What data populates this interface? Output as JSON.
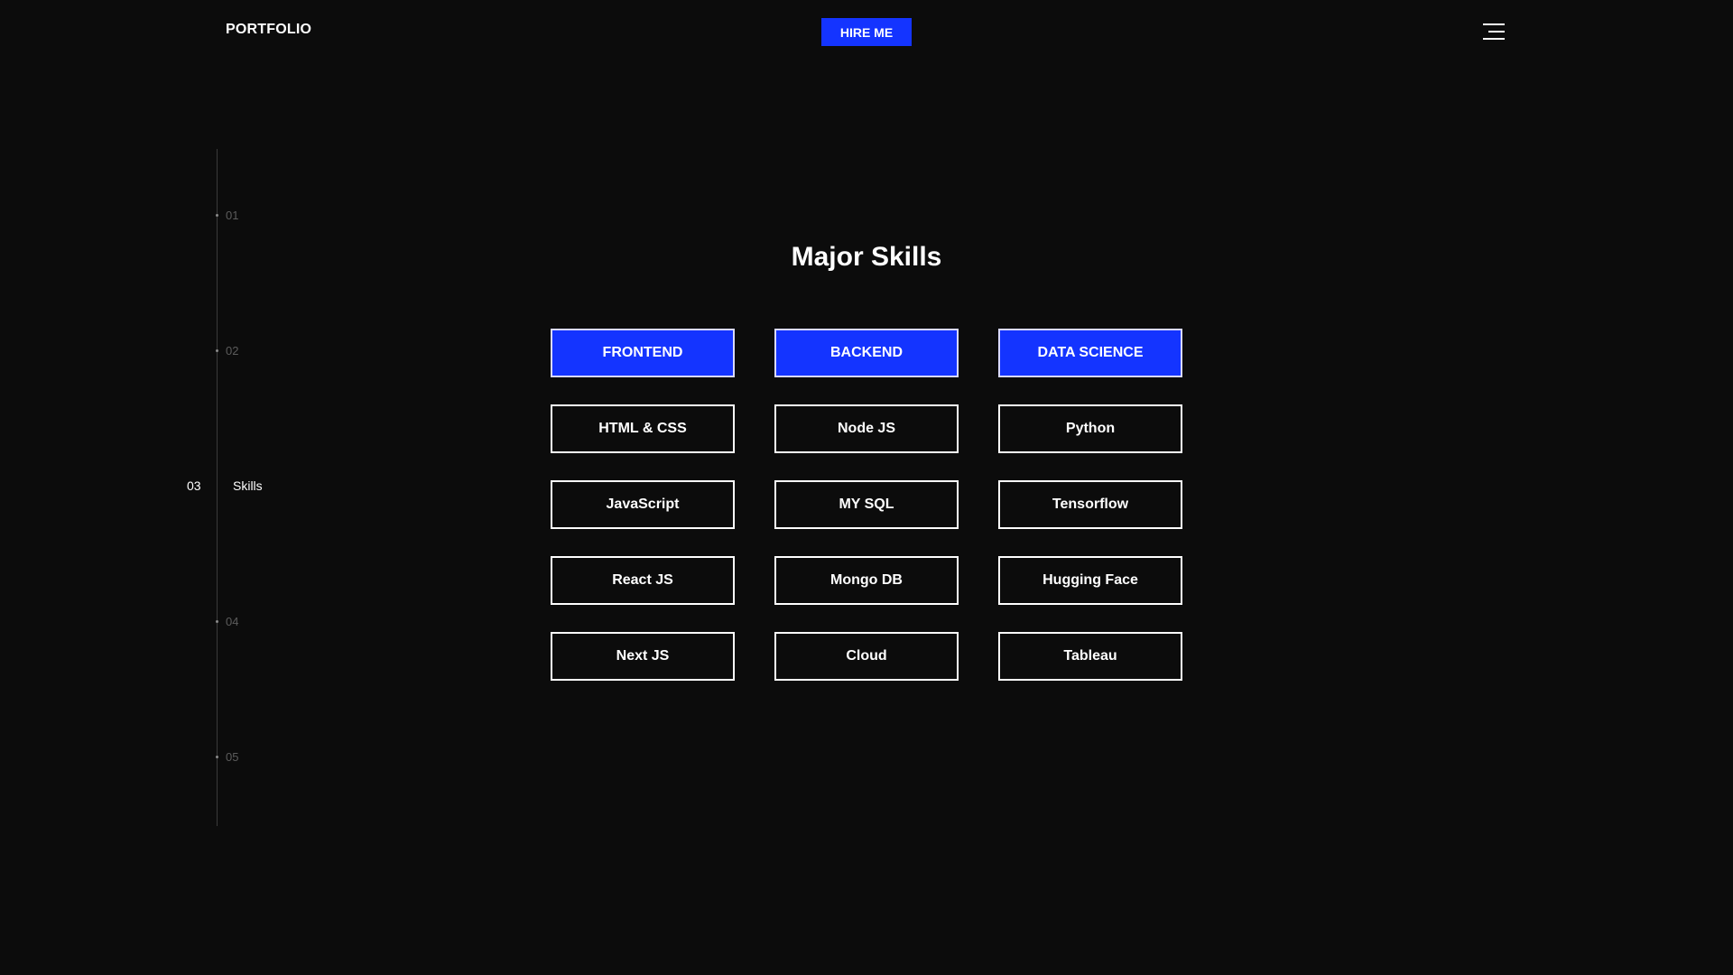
{
  "header": {
    "logo": "PORTFOLIO",
    "hire_label": "HIRE ME",
    "menu_icon": "hamburger-menu-icon"
  },
  "colors": {
    "accent": "#1434ff",
    "background": "#0c0c0c"
  },
  "side_nav": {
    "items": [
      {
        "number": "01"
      },
      {
        "number": "02"
      },
      {
        "number": "03",
        "label": "Skills",
        "active": true
      },
      {
        "number": "04"
      },
      {
        "number": "05"
      }
    ]
  },
  "main": {
    "title": "Major Skills",
    "categories": [
      "FRONTEND",
      "BACKEND",
      "DATA SCIENCE"
    ],
    "skills": [
      [
        "HTML & CSS",
        "Node JS",
        "Python"
      ],
      [
        "JavaScript",
        "MY SQL",
        "Tensorflow"
      ],
      [
        "React JS",
        "Mongo DB",
        "Hugging Face"
      ],
      [
        "Next JS",
        "Cloud",
        "Tableau"
      ]
    ]
  }
}
